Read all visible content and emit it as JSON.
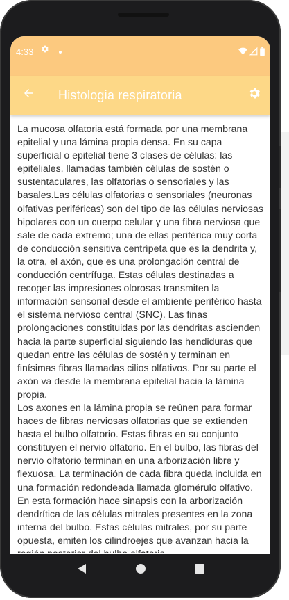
{
  "status_bar": {
    "time": "4:33",
    "icons": [
      "settings-icon",
      "notification-dot",
      "wifi-icon",
      "signal-icon",
      "battery-icon"
    ]
  },
  "app_bar": {
    "title": "Histologia respiratoria",
    "back_icon": "arrow-back-icon",
    "settings_icon": "gear-icon"
  },
  "article": {
    "paragraphs": [
      "La mucosa olfatoria está formada por una membrana epitelial y una lámina propia densa. En su capa superficial o epitelial tiene 3 clases de células: las epiteliales, llamadas también células de sostén o sustentaculares, las olfatorias o sensoriales y las basales.Las células olfatorias o sensoriales (neuronas olfativas periféricas) son del tipo de las células nerviosas bipolares con un cuerpo celular y una fibra nerviosa que sale de cada extremo; una de ellas periférica muy corta de conducción sensitiva centrípeta que es la dendrita y, la otra, el axón, que es una prolongación central de conducción centrífuga. Estas células destinadas a recoger las impresiones olorosas transmiten la información sensorial desde el ambiente periférico hasta el sistema nervioso central (SNC). Las finas prolongaciones constituidas por las dendritas ascienden hacia la parte superficial siguiendo las hendiduras que quedan entre las células de sostén y terminan en finísimas fibras llamadas cilios olfativos. Por su parte el axón va desde la membrana epitelial hacia la lámina propia.",
      "Los axones en la lámina propia se reúnen para formar haces de fibras nerviosas olfatorias que se extienden hasta el bulbo olfatorio. Estas fibras en su conjunto constituyen el nervio olfatorio. En el bulbo, las fibras del nervio olfatorio terminan en una arborización libre y flexuosa. La terminación de cada fibra queda incluida en una formación redondeada llamada glomérulo olfativo. En esta formación hace sinapsis con la arborización dendrítica de las células mitrales presentes en la zona interna del bulbo. Estas células mitrales, por su parte opuesta, emiten los cilindroejes que avanzan hacia la región posterior del bulbo olfatorio"
    ]
  },
  "nav_bar": {
    "buttons": [
      "back-triangle-icon",
      "home-circle-icon",
      "recents-square-icon"
    ]
  },
  "colors": {
    "status_bar": "#fcc97f",
    "app_bar": "#fdd887",
    "text": "#333333",
    "frame": "#1c1c1e"
  }
}
